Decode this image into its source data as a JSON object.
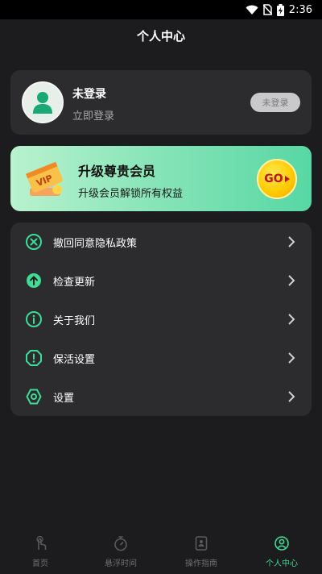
{
  "status_bar": {
    "time": "2:36"
  },
  "header": {
    "title": "个人中心"
  },
  "profile": {
    "name": "未登录",
    "subtitle": "立即登录",
    "login_button": "未登录"
  },
  "vip": {
    "title": "升级尊贵会员",
    "subtitle": "升级会员解锁所有权益",
    "badge_text": "VIP",
    "go_label": "GO"
  },
  "menu": {
    "items": [
      {
        "label": "撤回同意隐私政策",
        "icon": "x-circle-icon"
      },
      {
        "label": "检查更新",
        "icon": "arrow-up-circle-icon"
      },
      {
        "label": "关于我们",
        "icon": "info-circle-icon"
      },
      {
        "label": "保活设置",
        "icon": "alert-octagon-icon"
      },
      {
        "label": "设置",
        "icon": "gear-icon"
      }
    ]
  },
  "tabbar": {
    "items": [
      {
        "label": "首页",
        "icon": "tap-hand-icon"
      },
      {
        "label": "悬浮时间",
        "icon": "stopwatch-icon"
      },
      {
        "label": "操作指南",
        "icon": "guide-book-icon"
      },
      {
        "label": "个人中心",
        "icon": "person-circle-icon"
      }
    ],
    "active_index": 3
  },
  "colors": {
    "accent": "#3ddc97",
    "background": "#1c1c1e",
    "card": "#2c2c2e"
  }
}
